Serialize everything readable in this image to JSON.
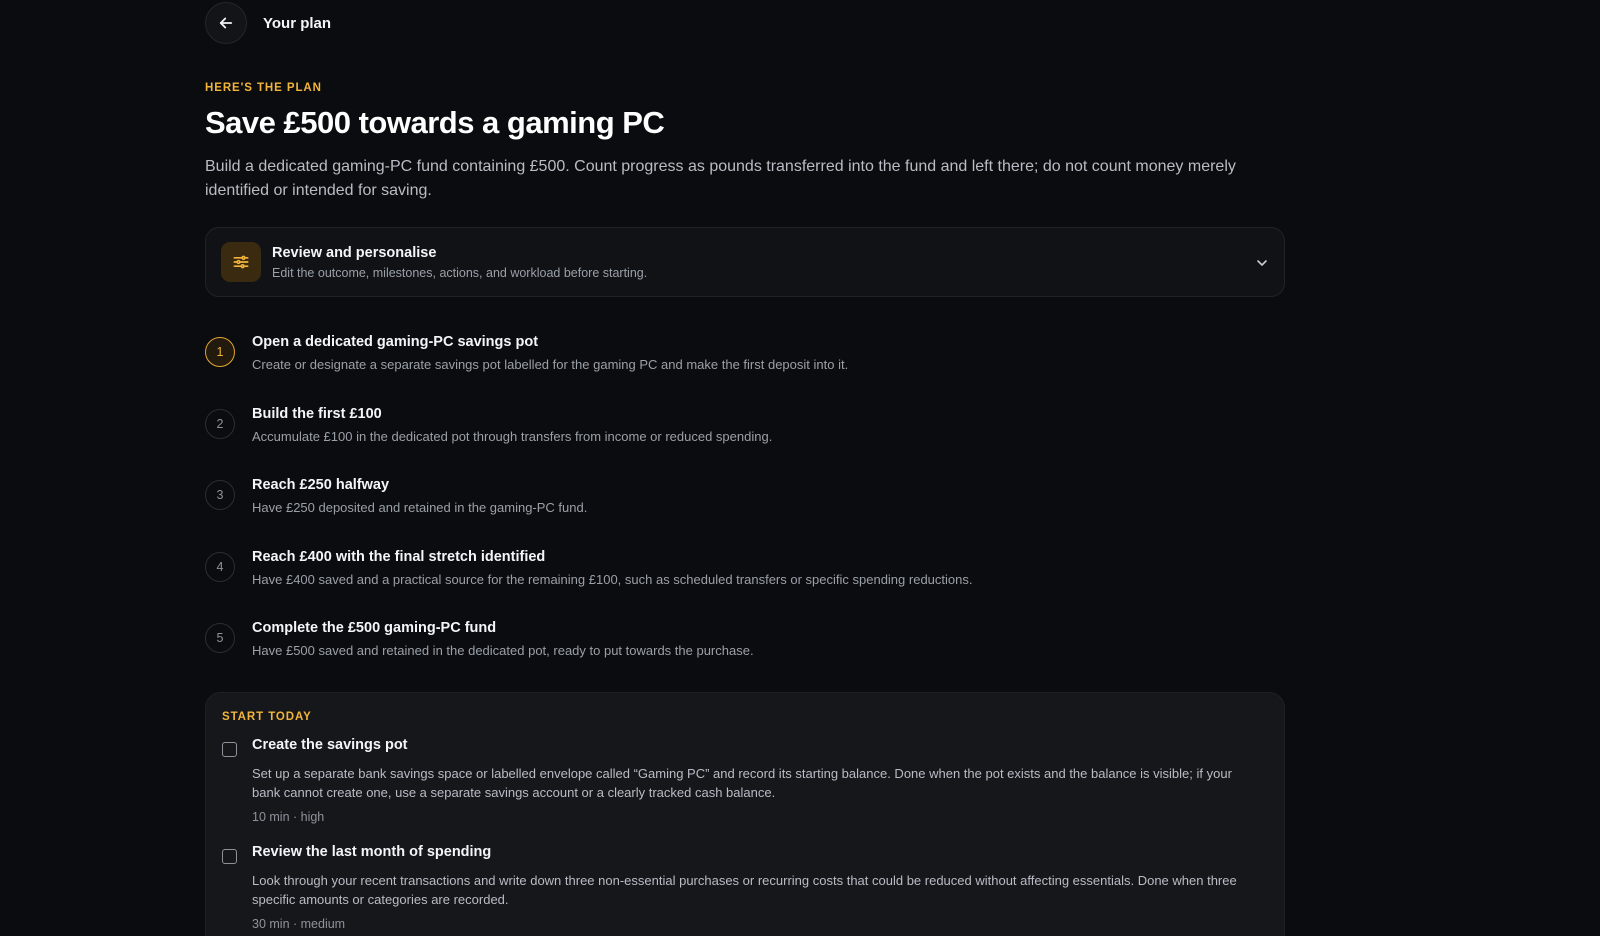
{
  "header": {
    "back_icon": "arrow-left-icon",
    "title": "Your plan"
  },
  "plan": {
    "eyebrow": "HERE'S THE PLAN",
    "title": "Save £500 towards a gaming PC",
    "description": "Build a dedicated gaming-PC fund containing £500. Count progress as pounds transferred into the fund and left there; do not count money merely identified or intended for saving."
  },
  "review": {
    "icon": "sliders-icon",
    "title": "Review and personalise",
    "subtitle": "Edit the outcome, milestones, actions, and workload before starting.",
    "chevron_icon": "chevron-down-icon"
  },
  "milestones": [
    {
      "number": "1",
      "title": "Open a dedicated gaming-PC savings pot",
      "description": "Create or designate a separate savings pot labelled for the gaming PC and make the first deposit into it."
    },
    {
      "number": "2",
      "title": "Build the first £100",
      "description": "Accumulate £100 in the dedicated pot through transfers from income or reduced spending."
    },
    {
      "number": "3",
      "title": "Reach £250 halfway",
      "description": "Have £250 deposited and retained in the gaming-PC fund."
    },
    {
      "number": "4",
      "title": "Reach £400 with the final stretch identified",
      "description": "Have £400 saved and a practical source for the remaining £100, such as scheduled transfers or specific spending reductions."
    },
    {
      "number": "5",
      "title": "Complete the £500 gaming-PC fund",
      "description": "Have £500 saved and retained in the dedicated pot, ready to put towards the purchase."
    }
  ],
  "start_today": {
    "eyebrow": "START TODAY",
    "tasks": [
      {
        "title": "Create the savings pot",
        "description": "Set up a separate bank savings space or labelled envelope called “Gaming PC” and record its starting balance. Done when the pot exists and the balance is visible; if your bank cannot create one, use a separate savings account or a clearly tracked cash balance.",
        "meta": "10 min · high",
        "checked": false
      },
      {
        "title": "Review the last month of spending",
        "description": "Look through your recent transactions and write down three non-essential purchases or recurring costs that could be reduced without affecting essentials. Done when three specific amounts or categories are recorded.",
        "meta": "30 min · medium",
        "checked": false
      }
    ]
  },
  "colors": {
    "background": "#0b0c0f",
    "accent": "#f2b43a",
    "card": "#15171b"
  }
}
